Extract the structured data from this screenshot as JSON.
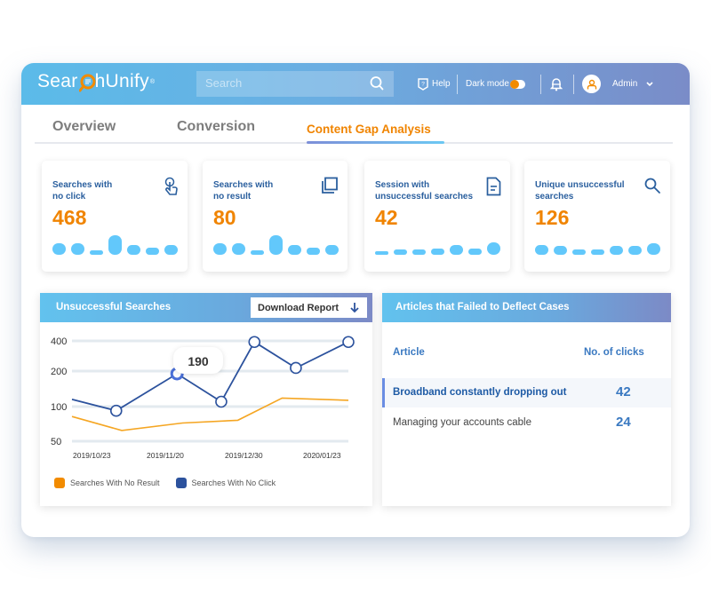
{
  "app": {
    "logo_text_before": "Sear",
    "logo_text_after": "hUnify",
    "logo_mark": "®"
  },
  "header": {
    "search_placeholder": "Search",
    "help_label": "Help",
    "dark_mode_label": "Dark mode",
    "dark_mode_on": false,
    "user_label": "Admin"
  },
  "tabs": [
    {
      "label": "Overview",
      "active": false
    },
    {
      "label": "Conversion",
      "active": false
    },
    {
      "label": "Content Gap Analysis",
      "active": true
    }
  ],
  "cards": [
    {
      "title_line1": "Searches with",
      "title_line2": "no click",
      "value": "468",
      "icon": "pointer-hand-icon",
      "spark": [
        0.55,
        0.55,
        0.2,
        0.9,
        0.45,
        0.35,
        0.45
      ]
    },
    {
      "title_line1": "Searches with",
      "title_line2": "no result",
      "value": "80",
      "icon": "copy-icon",
      "spark": [
        0.55,
        0.55,
        0.2,
        0.9,
        0.45,
        0.35,
        0.45
      ]
    },
    {
      "title_line1": "Session with",
      "title_line2": "unsuccessful searches",
      "value": "42",
      "icon": "document-icon",
      "spark": [
        0.12,
        0.25,
        0.25,
        0.3,
        0.45,
        0.3,
        0.6
      ]
    },
    {
      "title_line1": "Unique unsuccessful",
      "title_line2": "searches",
      "value": "126",
      "icon": "search-icon",
      "spark": [
        0.45,
        0.4,
        0.25,
        0.25,
        0.4,
        0.4,
        0.55
      ]
    }
  ],
  "unsuccessful_panel": {
    "title": "Unsuccessful Searches",
    "download_label": "Download Report",
    "tooltip_value": "190"
  },
  "chart_data": {
    "type": "line",
    "title": "Unsuccessful Searches",
    "xlabel": "",
    "ylabel": "",
    "y_ticks": [
      50,
      100,
      200,
      400
    ],
    "x_tick_labels": [
      "2019/10/23",
      "2019/11/20",
      "2019/12/30",
      "2020/01/23"
    ],
    "grid": true,
    "legend_position": "bottom-left",
    "series": [
      {
        "name": "Searches With No Result",
        "color": "#f39c12",
        "points": [
          [
            0,
            82
          ],
          [
            0.18,
            62
          ],
          [
            0.4,
            72
          ],
          [
            0.6,
            76
          ],
          [
            0.76,
            118
          ],
          [
            1.0,
            113
          ]
        ]
      },
      {
        "name": "Searches With No Click",
        "color": "#2c529d",
        "points": [
          [
            0,
            115
          ],
          [
            0.16,
            92
          ],
          [
            0.38,
            190
          ],
          [
            0.54,
            110
          ],
          [
            0.66,
            390
          ],
          [
            0.81,
            215
          ],
          [
            1.0,
            390
          ]
        ],
        "markers": [
          1,
          2,
          3,
          4,
          5,
          6
        ],
        "highlight_index": 2
      }
    ]
  },
  "articles_panel": {
    "title": "Articles that Failed to Deflect Cases",
    "col_article": "Article",
    "col_clicks": "No. of clicks",
    "rows": [
      {
        "article": "Broadband constantly dropping out",
        "clicks": "42",
        "active": true
      },
      {
        "article": "Managing your accounts cable",
        "clicks": "24",
        "active": false
      }
    ]
  }
}
